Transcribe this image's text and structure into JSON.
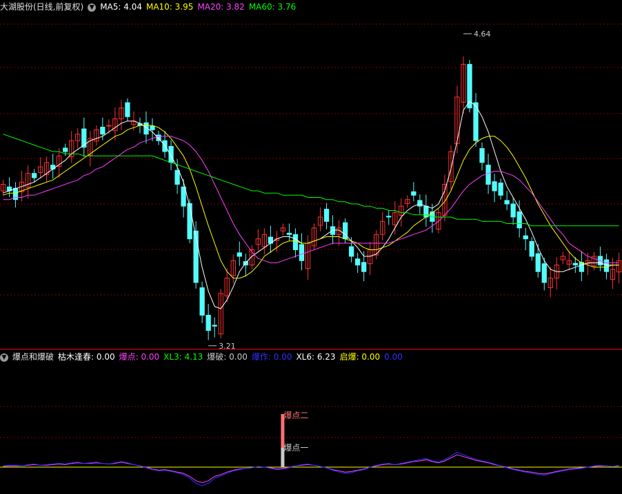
{
  "main_panel": {
    "title": "大湖股份(日线,前复权)",
    "legend": [
      {
        "label": "MA5: 4.04",
        "color": "#ffffff"
      },
      {
        "label": "MA10: 3.95",
        "color": "#ffff00"
      },
      {
        "label": "MA20: 3.82",
        "color": "#ff40ff"
      },
      {
        "label": "MA60: 3.76",
        "color": "#00ff00"
      }
    ],
    "high_label": "4.64",
    "low_label": "3.21",
    "colors": {
      "up": "#ff3232",
      "down": "#54fcfc",
      "grid": "#8b0000"
    }
  },
  "indicator_panel": {
    "title": "爆点和爆破",
    "legend": [
      {
        "label": "枯木逢春: 0.00",
        "color": "#ffffff"
      },
      {
        "label": "爆点: 0.00",
        "color": "#ff40ff"
      },
      {
        "label": "XL3: 4.13",
        "color": "#00ff00"
      },
      {
        "label": "爆破: 0.00",
        "color": "#c8c8c8"
      },
      {
        "label": "爆作: 0.00",
        "color": "#3030ff"
      },
      {
        "label": "XL6: 6.23",
        "color": "#ffffff"
      },
      {
        "label": "启爆: 0.00",
        "color": "#ffff00"
      },
      {
        "label": "0.00",
        "color": "#3030ff"
      }
    ],
    "marker_upper": "爆点二",
    "marker_lower": "爆点一"
  },
  "chart_data": {
    "type": "candlestick",
    "price_range": [
      3.2,
      4.7
    ],
    "high": 4.64,
    "low": 3.21,
    "closes": [
      3.95,
      3.92,
      3.88,
      3.96,
      4.0,
      3.98,
      4.03,
      4.05,
      4.02,
      4.08,
      4.1,
      4.15,
      4.18,
      4.12,
      4.16,
      4.2,
      4.18,
      4.22,
      4.25,
      4.3,
      4.26,
      4.24,
      4.22,
      4.18,
      4.2,
      4.15,
      4.1,
      4.05,
      3.95,
      3.85,
      3.7,
      3.5,
      3.35,
      3.28,
      3.3,
      3.45,
      3.52,
      3.6,
      3.62,
      3.58,
      3.65,
      3.7,
      3.72,
      3.68,
      3.7,
      3.75,
      3.72,
      3.65,
      3.6,
      3.68,
      3.75,
      3.8,
      3.78,
      3.72,
      3.75,
      3.7,
      3.62,
      3.58,
      3.55,
      3.65,
      3.72,
      3.78,
      3.8,
      3.82,
      3.85,
      3.88,
      3.9,
      3.85,
      3.8,
      3.78,
      3.82,
      3.95,
      4.1,
      4.35,
      4.5,
      4.3,
      4.15,
      4.05,
      3.95,
      3.92,
      3.9,
      3.86,
      3.8,
      3.75,
      3.7,
      3.62,
      3.55,
      3.5,
      3.52,
      3.58,
      3.62,
      3.6,
      3.58,
      3.55,
      3.6,
      3.62,
      3.58,
      3.55,
      3.56,
      3.6
    ],
    "series": [
      {
        "name": "MA5",
        "values": [
          3.91,
          3.92,
          3.93,
          3.94,
          3.95,
          3.96,
          3.98,
          4.0,
          4.02,
          4.04,
          4.06,
          4.09,
          4.11,
          4.13,
          4.15,
          4.16,
          4.17,
          4.19,
          4.21,
          4.23,
          4.24,
          4.24,
          4.23,
          4.21,
          4.19,
          4.16,
          4.13,
          4.08,
          4.03,
          3.96,
          3.85,
          3.71,
          3.57,
          3.46,
          3.39,
          3.38,
          3.42,
          3.48,
          3.55,
          3.59,
          3.62,
          3.64,
          3.66,
          3.68,
          3.7,
          3.71,
          3.71,
          3.7,
          3.68,
          3.68,
          3.69,
          3.7,
          3.72,
          3.74,
          3.74,
          3.72,
          3.69,
          3.66,
          3.62,
          3.62,
          3.63,
          3.66,
          3.7,
          3.75,
          3.8,
          3.83,
          3.85,
          3.86,
          3.85,
          3.84,
          3.86,
          3.92,
          4.02,
          4.15,
          4.29,
          4.33,
          4.31,
          4.26,
          4.19,
          4.1,
          4.01,
          3.94,
          3.89,
          3.84,
          3.79,
          3.73,
          3.66,
          3.6,
          3.56,
          3.55,
          3.55,
          3.56,
          3.57,
          3.58,
          3.59,
          3.59,
          3.59,
          3.58,
          3.58,
          3.58
        ]
      },
      {
        "name": "MA10",
        "values": [
          3.9,
          3.91,
          3.91,
          3.92,
          3.93,
          3.94,
          3.95,
          3.96,
          3.97,
          3.99,
          4.01,
          4.03,
          4.05,
          4.07,
          4.09,
          4.11,
          4.13,
          4.15,
          4.17,
          4.18,
          4.2,
          4.21,
          4.22,
          4.22,
          4.22,
          4.21,
          4.19,
          4.16,
          4.12,
          4.08,
          4.02,
          3.94,
          3.85,
          3.76,
          3.68,
          3.6,
          3.55,
          3.52,
          3.52,
          3.53,
          3.55,
          3.58,
          3.62,
          3.64,
          3.66,
          3.68,
          3.69,
          3.69,
          3.68,
          3.68,
          3.69,
          3.7,
          3.71,
          3.71,
          3.71,
          3.7,
          3.69,
          3.68,
          3.66,
          3.65,
          3.65,
          3.66,
          3.67,
          3.69,
          3.71,
          3.73,
          3.76,
          3.78,
          3.8,
          3.82,
          3.84,
          3.87,
          3.92,
          3.99,
          4.06,
          4.11,
          4.14,
          4.16,
          4.17,
          4.17,
          4.15,
          4.12,
          4.08,
          4.03,
          3.98,
          3.92,
          3.86,
          3.81,
          3.76,
          3.72,
          3.68,
          3.64,
          3.61,
          3.59,
          3.58,
          3.57,
          3.57,
          3.57,
          3.58,
          3.58
        ]
      },
      {
        "name": "MA20",
        "values": [
          3.88,
          3.88,
          3.89,
          3.89,
          3.9,
          3.9,
          3.91,
          3.92,
          3.93,
          3.94,
          3.95,
          3.96,
          3.97,
          3.99,
          4.0,
          4.02,
          4.03,
          4.05,
          4.07,
          4.09,
          4.11,
          4.12,
          4.14,
          4.15,
          4.16,
          4.17,
          4.17,
          4.17,
          4.16,
          4.15,
          4.13,
          4.1,
          4.06,
          4.01,
          3.95,
          3.89,
          3.83,
          3.77,
          3.72,
          3.68,
          3.64,
          3.61,
          3.6,
          3.59,
          3.59,
          3.6,
          3.61,
          3.62,
          3.63,
          3.64,
          3.65,
          3.66,
          3.67,
          3.68,
          3.68,
          3.68,
          3.68,
          3.68,
          3.68,
          3.68,
          3.68,
          3.68,
          3.68,
          3.69,
          3.7,
          3.71,
          3.72,
          3.73,
          3.74,
          3.76,
          3.78,
          3.81,
          3.84,
          3.88,
          3.92,
          3.95,
          3.97,
          3.99,
          4.0,
          4.01,
          4.01,
          4.0,
          3.99,
          3.97,
          3.94,
          3.91,
          3.87,
          3.83,
          3.79,
          3.75,
          3.72,
          3.68,
          3.66,
          3.64,
          3.62,
          3.61,
          3.6,
          3.59,
          3.59,
          3.59
        ]
      },
      {
        "name": "MA60",
        "values": [
          4.18,
          4.17,
          4.16,
          4.15,
          4.14,
          4.13,
          4.12,
          4.11,
          4.1,
          4.1,
          4.09,
          4.09,
          4.09,
          4.08,
          4.08,
          4.08,
          4.08,
          4.08,
          4.08,
          4.08,
          4.08,
          4.08,
          4.08,
          4.08,
          4.08,
          4.07,
          4.06,
          4.05,
          4.04,
          4.03,
          4.02,
          4.01,
          4.0,
          3.99,
          3.98,
          3.97,
          3.96,
          3.95,
          3.94,
          3.93,
          3.92,
          3.92,
          3.91,
          3.91,
          3.91,
          3.9,
          3.9,
          3.9,
          3.9,
          3.89,
          3.89,
          3.89,
          3.88,
          3.88,
          3.87,
          3.87,
          3.86,
          3.86,
          3.85,
          3.85,
          3.84,
          3.84,
          3.83,
          3.83,
          3.82,
          3.82,
          3.81,
          3.81,
          3.81,
          3.8,
          3.8,
          3.8,
          3.8,
          3.79,
          3.79,
          3.79,
          3.79,
          3.78,
          3.78,
          3.78,
          3.78,
          3.77,
          3.77,
          3.77,
          3.77,
          3.76,
          3.76,
          3.76,
          3.76,
          3.76,
          3.76,
          3.76,
          3.76,
          3.76,
          3.76,
          3.76,
          3.76,
          3.76,
          3.76,
          3.76
        ]
      }
    ],
    "indicator": {
      "line_a": [
        0.2,
        0.3,
        0.3,
        0.2,
        0.4,
        0.5,
        0.3,
        0.4,
        0.5,
        0.6,
        0.5,
        0.7,
        0.8,
        0.6,
        0.7,
        0.8,
        0.6,
        0.5,
        0.7,
        0.9,
        0.7,
        0.4,
        0.2,
        -0.1,
        -0.4,
        -0.6,
        -0.5,
        -0.7,
        -0.9,
        -1.2,
        -1.8,
        -2.6,
        -3.0,
        -2.6,
        -1.8,
        -1.4,
        -1.0,
        -0.6,
        -0.4,
        -0.2,
        -0.1,
        0.1,
        0.0,
        -0.2,
        -0.4,
        -0.3,
        -0.1,
        0.2,
        0.4,
        0.5,
        0.3,
        0.1,
        -0.1,
        -0.5,
        -0.8,
        -1.0,
        -0.9,
        -0.6,
        -0.4,
        0.0,
        0.3,
        0.5,
        0.6,
        0.4,
        0.6,
        0.8,
        1.0,
        1.2,
        1.4,
        1.0,
        0.8,
        1.2,
        1.8,
        2.4,
        2.0,
        1.6,
        1.3,
        1.0,
        0.8,
        0.5,
        0.2,
        -0.1,
        -0.4,
        -0.6,
        -0.8,
        -1.0,
        -1.2,
        -1.3,
        -1.0,
        -0.8,
        -0.6,
        -0.4,
        -0.3,
        -0.2,
        0.0,
        0.2,
        0.3,
        0.2,
        0.1,
        0.3
      ],
      "line_b": [
        0.1,
        0.2,
        0.2,
        0.2,
        0.3,
        0.4,
        0.3,
        0.3,
        0.4,
        0.5,
        0.4,
        0.6,
        0.7,
        0.6,
        0.6,
        0.7,
        0.6,
        0.5,
        0.6,
        0.8,
        0.6,
        0.4,
        0.2,
        0.0,
        -0.3,
        -0.5,
        -0.4,
        -0.6,
        -0.8,
        -1.0,
        -1.5,
        -2.2,
        -2.5,
        -2.2,
        -1.5,
        -1.2,
        -0.8,
        -0.5,
        -0.3,
        -0.2,
        -0.1,
        0.1,
        0.0,
        -0.1,
        -0.3,
        -0.2,
        0.0,
        0.2,
        0.3,
        0.4,
        0.3,
        0.1,
        -0.1,
        -0.4,
        -0.6,
        -0.8,
        -0.7,
        -0.5,
        -0.3,
        0.0,
        0.2,
        0.4,
        0.5,
        0.4,
        0.5,
        0.7,
        0.9,
        1.0,
        1.2,
        0.9,
        0.7,
        1.0,
        1.5,
        2.0,
        1.7,
        1.4,
        1.1,
        0.9,
        0.7,
        0.4,
        0.2,
        0.0,
        -0.3,
        -0.5,
        -0.7,
        -0.8,
        -1.0,
        -1.1,
        -0.9,
        -0.7,
        -0.5,
        -0.3,
        -0.2,
        -0.1,
        0.0,
        0.1,
        0.2,
        0.2,
        0.1,
        0.2
      ],
      "signal_index": 45,
      "signal_value_upper": 11,
      "signal_value_lower": 4
    }
  }
}
